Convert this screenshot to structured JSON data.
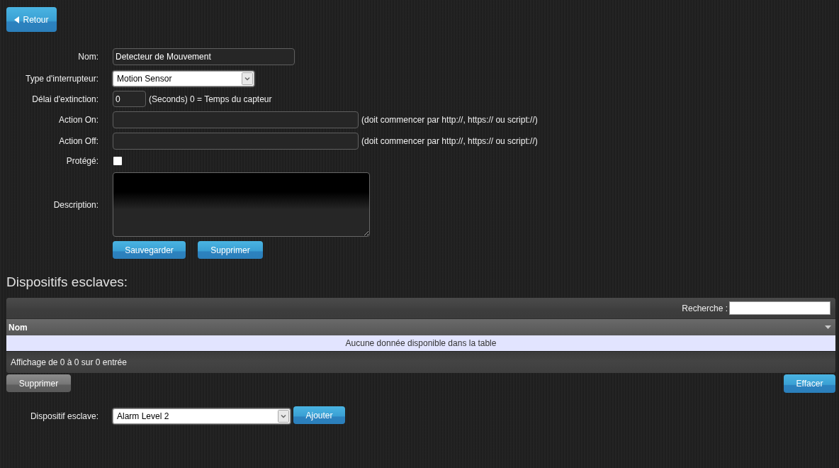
{
  "back_button": {
    "label": "Retour"
  },
  "form": {
    "fields": [
      {
        "kind": "text",
        "label": "Nom:",
        "value": "Detecteur de Mouvement"
      },
      {
        "kind": "select",
        "label": "Type d'interrupteur:",
        "value": "Motion Sensor"
      },
      {
        "kind": "number",
        "label": "Délai d'extinction:",
        "value": "0",
        "hint": "(Seconds) 0 = Temps du capteur"
      },
      {
        "kind": "url",
        "label": "Action On:",
        "hint": "(doit commencer par http://, https:// ou script://)"
      },
      {
        "kind": "url",
        "label": "Action Off:",
        "hint": "(doit commencer par http://, https:// ou script://)"
      },
      {
        "kind": "checkbox",
        "label": "Protégé:",
        "checked": false
      },
      {
        "kind": "textarea",
        "label": "Description:"
      }
    ],
    "buttons": [
      "Sauvegarder",
      "Supprimer"
    ]
  },
  "slaves": {
    "title": "Dispositifs esclaves:",
    "search": {
      "label": "Recherche :"
    },
    "columns": [
      "Nom"
    ],
    "empty_message": "Aucune donnée disponible dans la table",
    "info": "Affichage de 0 à 0 sur 0 entrée",
    "buttons": [
      {
        "label": "Supprimer",
        "disabled": true
      },
      {
        "label": "Effacer",
        "disabled": false
      }
    ]
  },
  "add": {
    "label": "Dispositif esclave:",
    "value": "Alarm Level 2",
    "button": "Ajouter"
  }
}
